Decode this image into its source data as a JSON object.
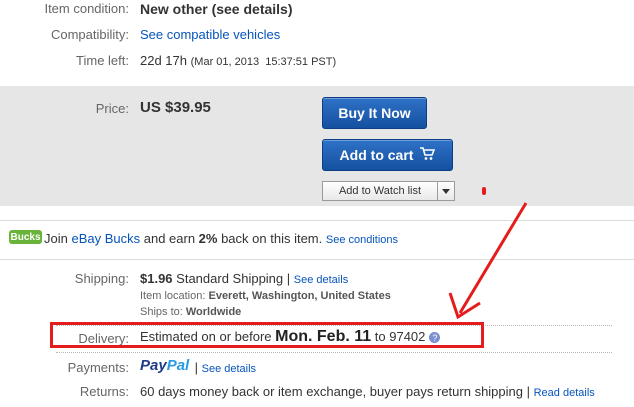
{
  "item_condition": {
    "label": "Item condition:",
    "value": "New other (see details)"
  },
  "compatibility": {
    "label": "Compatibility:",
    "link": "See compatible vehicles"
  },
  "time_left": {
    "label": "Time left:",
    "value": "22d 17h",
    "date": "(Mar 01, 2013  15:37:51 PST)"
  },
  "price": {
    "label": "Price:",
    "value": "US $39.95"
  },
  "buttons": {
    "buy_now": "Buy It Now",
    "add_to_cart": "Add to cart",
    "watch": "Add to Watch list",
    "cart_icon": "shopping-cart-icon"
  },
  "bucks": {
    "badge": "Bucks",
    "prefix": "Join ",
    "brand": "eBay Bucks",
    "middle": " and earn ",
    "percent": "2%",
    "suffix": " back on this item.",
    "link": "See conditions"
  },
  "shipping": {
    "label": "Shipping:",
    "cost": "$1.96",
    "method": "Standard Shipping",
    "sep": " | ",
    "link": "See details",
    "location_label": "Item location:",
    "location": "Everett, Washington, United States",
    "ships_label": "Ships to:",
    "ships": "Worldwide"
  },
  "delivery": {
    "label": "Delivery:",
    "prefix": "Estimated on or before ",
    "date": "Mon. Feb. 11",
    "to": " to ",
    "zip": "97402",
    "help_icon": "?"
  },
  "payments": {
    "label": "Payments:",
    "brand_a": "Pay",
    "brand_b": "Pal",
    "sep": " | ",
    "link": "See details"
  },
  "returns": {
    "label": "Returns:",
    "value": "60 days money back or item exchange, buyer pays return shipping",
    "sep": " | ",
    "link": "Read details"
  },
  "colors": {
    "accent_blue": "#0654ba",
    "annotation_red": "#e41c1c",
    "bucks_green": "#6ab33a"
  }
}
